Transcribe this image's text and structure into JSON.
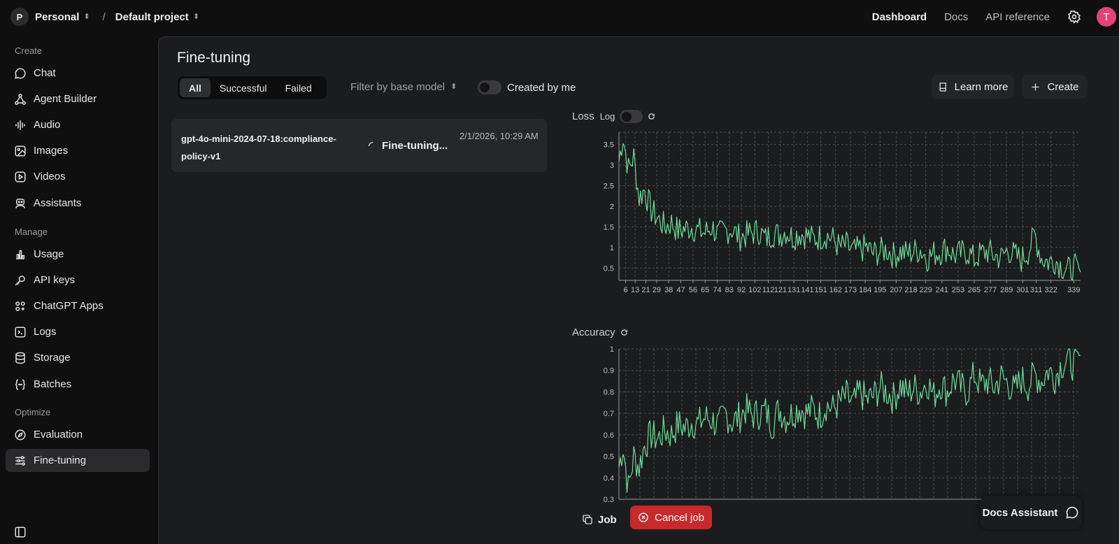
{
  "topbar": {
    "org_initial": "P",
    "org_name": "Personal",
    "separator": "/",
    "project_name": "Default project",
    "nav": [
      "Dashboard",
      "Docs",
      "API reference"
    ],
    "user_initial": "T",
    "user_color": "#e8417a"
  },
  "sidebar": {
    "sections": [
      {
        "label": "Create",
        "items": [
          "Chat",
          "Agent Builder",
          "Audio",
          "Images",
          "Videos",
          "Assistants"
        ]
      },
      {
        "label": "Manage",
        "items": [
          "Usage",
          "API keys",
          "ChatGPT Apps",
          "Logs",
          "Storage",
          "Batches"
        ]
      },
      {
        "label": "Optimize",
        "items": [
          "Evaluation",
          "Fine-tuning"
        ]
      }
    ],
    "active_item": "Fine-tuning"
  },
  "page": {
    "title": "Fine-tuning",
    "tabs": [
      "All",
      "Successful",
      "Failed"
    ],
    "active_tab": "All",
    "filter_label": "Filter by base model",
    "created_by_me_label": "Created by me",
    "learn_more": "Learn more",
    "create": "Create"
  },
  "job": {
    "name": "gpt-4o-mini-2024-07-18:compliance-policy-v1",
    "status": "Fine-tuning...",
    "created": "2/1/2026, 10:29 AM"
  },
  "metrics": {
    "loss_label": "Loss",
    "log_label": "Log",
    "accuracy_label": "Accuracy"
  },
  "actions": {
    "job": "Job",
    "cancel": "Cancel job",
    "docs_assistant": "Docs Assistant"
  },
  "colors": {
    "accent_line": "#6fdc9c",
    "cancel": "#c72a2a"
  },
  "chart_data": [
    {
      "type": "line",
      "title": "Loss",
      "xlabel": "",
      "ylabel": "",
      "x_ticks": [
        6,
        13,
        21,
        29,
        38,
        47,
        56,
        65,
        74,
        83,
        92,
        102,
        112,
        121,
        131,
        141,
        151,
        162,
        173,
        184,
        195,
        207,
        218,
        229,
        241,
        253,
        265,
        277,
        289,
        301,
        311,
        322,
        339
      ],
      "y_ticks": [
        0.5,
        1,
        1.5,
        2,
        2.5,
        3,
        3.5
      ],
      "xlim": [
        1,
        344
      ],
      "ylim": [
        0.2,
        3.8
      ],
      "grid": true,
      "series": [
        {
          "x": [
            1,
            4,
            8,
            12,
            16,
            20,
            25,
            30,
            35,
            40,
            45,
            50,
            55,
            60,
            65,
            70,
            75,
            80,
            85,
            90,
            95,
            100,
            105,
            110,
            115,
            120,
            125,
            130,
            135,
            140,
            145,
            150,
            155,
            160,
            165,
            170,
            175,
            180,
            185,
            190,
            195,
            200,
            205,
            210,
            215,
            220,
            225,
            230,
            235,
            240,
            245,
            250,
            255,
            260,
            265,
            270,
            275,
            280,
            285,
            290,
            295,
            300,
            305,
            310,
            315,
            320,
            325,
            330,
            335,
            340,
            344
          ],
          "y": [
            3.1,
            3.7,
            2.9,
            3.2,
            2.2,
            2.4,
            1.9,
            1.7,
            1.5,
            1.6,
            1.4,
            1.45,
            1.5,
            1.4,
            1.35,
            1.5,
            1.3,
            1.4,
            1.45,
            1.25,
            1.3,
            1.35,
            1.4,
            1.2,
            1.35,
            1.3,
            1.4,
            1.25,
            1.35,
            1.3,
            1.2,
            1.25,
            1.3,
            1.2,
            1.0,
            1.05,
            0.9,
            0.95,
            1.0,
            0.85,
            0.9,
            0.95,
            0.8,
            0.9,
            0.85,
            0.9,
            0.95,
            0.75,
            0.85,
            0.9,
            1.0,
            0.8,
            0.85,
            0.9,
            0.7,
            0.85,
            0.9,
            0.8,
            0.75,
            0.95,
            0.8,
            0.7,
            0.9,
            1.3,
            0.75,
            0.65,
            0.7,
            0.55,
            0.45,
            0.5,
            0.4
          ]
        }
      ]
    },
    {
      "type": "line",
      "title": "Accuracy",
      "xlabel": "",
      "ylabel": "",
      "y_ticks": [
        0.3,
        0.4,
        0.5,
        0.6,
        0.7,
        0.8,
        0.9,
        1
      ],
      "xlim": [
        1,
        344
      ],
      "ylim": [
        0.3,
        1
      ],
      "grid": true,
      "series": [
        {
          "x": [
            1,
            4,
            8,
            12,
            16,
            20,
            25,
            30,
            35,
            40,
            45,
            50,
            55,
            60,
            65,
            70,
            75,
            80,
            85,
            90,
            95,
            100,
            105,
            110,
            115,
            120,
            125,
            130,
            135,
            140,
            145,
            150,
            155,
            160,
            165,
            170,
            175,
            180,
            185,
            190,
            195,
            200,
            205,
            210,
            215,
            220,
            225,
            230,
            235,
            240,
            245,
            250,
            255,
            260,
            265,
            270,
            275,
            280,
            285,
            290,
            295,
            300,
            305,
            310,
            315,
            320,
            325,
            330,
            335,
            340,
            344
          ],
          "y": [
            0.45,
            0.55,
            0.35,
            0.5,
            0.45,
            0.55,
            0.6,
            0.58,
            0.62,
            0.6,
            0.65,
            0.63,
            0.66,
            0.65,
            0.68,
            0.67,
            0.64,
            0.7,
            0.66,
            0.68,
            0.72,
            0.69,
            0.7,
            0.71,
            0.65,
            0.72,
            0.68,
            0.7,
            0.73,
            0.7,
            0.72,
            0.69,
            0.74,
            0.72,
            0.75,
            0.78,
            0.74,
            0.8,
            0.76,
            0.78,
            0.82,
            0.8,
            0.77,
            0.83,
            0.79,
            0.82,
            0.8,
            0.85,
            0.78,
            0.84,
            0.8,
            0.86,
            0.82,
            0.8,
            0.88,
            0.83,
            0.85,
            0.82,
            0.87,
            0.84,
            0.8,
            0.86,
            0.83,
            0.88,
            0.85,
            0.9,
            0.87,
            0.93,
            0.95,
            0.92,
            0.97
          ]
        }
      ]
    }
  ]
}
